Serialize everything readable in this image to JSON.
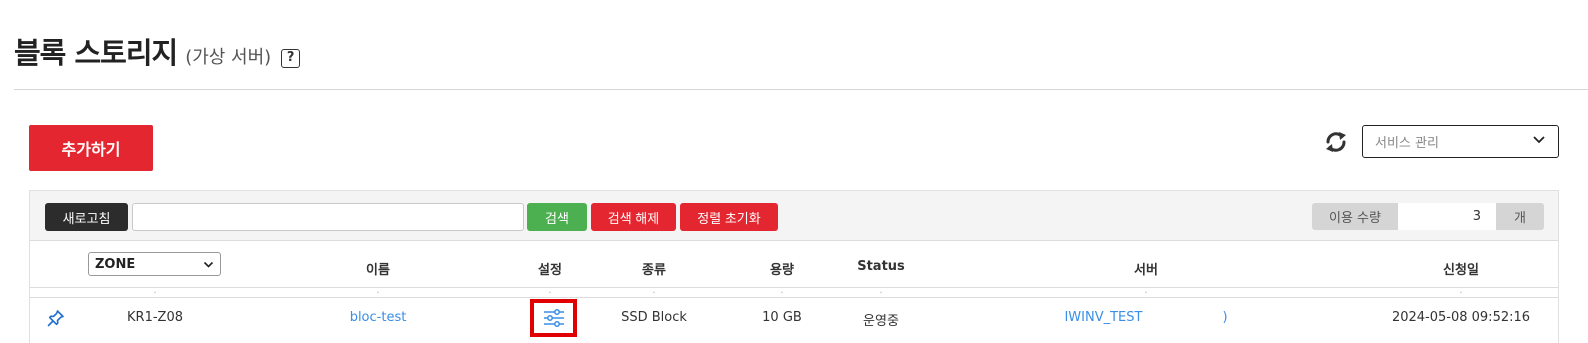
{
  "header": {
    "title": "블록 스토리지",
    "subtitle": "(가상 서버)",
    "help_label": "?"
  },
  "actions": {
    "add_label": "추가하기",
    "service_select_value": "서비스 관리"
  },
  "toolbar": {
    "refresh_label": "새로고침",
    "search_value": "",
    "search_label": "검색",
    "clear_search_label": "검색 해제",
    "reset_sort_label": "정렬 초기화",
    "usage_label": "이용 수량",
    "usage_count": "3",
    "usage_unit": "개"
  },
  "table": {
    "zone_filter_value": "ZONE",
    "columns": [
      "이름",
      "설정",
      "종류",
      "용량",
      "Status",
      "서버",
      "신청일"
    ],
    "rows": [
      {
        "zone": "KR1-Z08",
        "name": "bloc-test",
        "type": "SSD Block",
        "capacity": "10 GB",
        "status": "운영중",
        "server_prefix": "IWINV_TEST",
        "server_suffix": ")",
        "date": "2024-05-08 09:52:16"
      }
    ]
  },
  "colors": {
    "accent_red": "#e3262f",
    "search_green": "#4caf50",
    "link_blue": "#3a8ee6",
    "highlight_red": "#e00000"
  },
  "icons": [
    "help-icon",
    "refresh-icon",
    "chevron-down-icon",
    "pin-icon",
    "sliders-icon"
  ]
}
